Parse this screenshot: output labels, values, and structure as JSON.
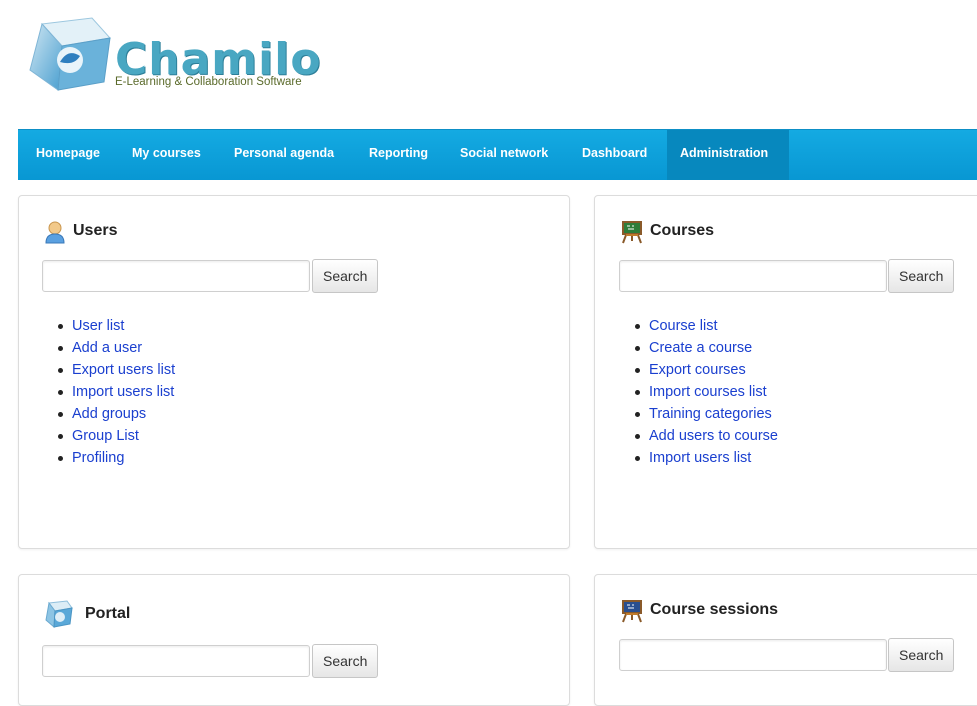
{
  "logo": {
    "name": "Chamilo",
    "tagline": "E-Learning & Collaboration Software"
  },
  "nav": {
    "items": [
      {
        "label": "Homepage"
      },
      {
        "label": "My courses"
      },
      {
        "label": "Personal agenda"
      },
      {
        "label": "Reporting"
      },
      {
        "label": "Social network"
      },
      {
        "label": "Dashboard"
      },
      {
        "label": "Administration",
        "active": true
      }
    ]
  },
  "panels": {
    "users": {
      "title": "Users",
      "icon": "user-icon",
      "search_label": "Search",
      "links": [
        "User list",
        "Add a user",
        "Export users list",
        "Import users list",
        "Add groups",
        "Group List",
        "Profiling"
      ]
    },
    "courses": {
      "title": "Courses",
      "icon": "blackboard-icon",
      "search_label": "Search",
      "links": [
        "Course list",
        "Create a course",
        "Export courses",
        "Import courses list",
        "Training categories",
        "Add users to course",
        "Import users list"
      ]
    },
    "portal": {
      "title": "Portal",
      "icon": "portal-icon",
      "search_label": "Search"
    },
    "sessions": {
      "title": "Course sessions",
      "icon": "blackboard-icon",
      "search_label": "Search"
    }
  },
  "colors": {
    "nav": "#0f9fd9",
    "nav_active": "#0788be",
    "link": "#1a3fcf"
  }
}
